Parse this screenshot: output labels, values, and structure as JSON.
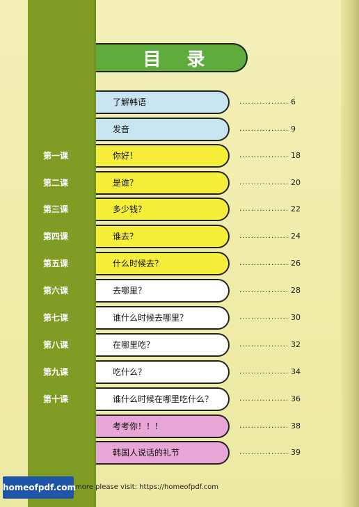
{
  "title": "目 录",
  "rows": [
    {
      "lesson": "",
      "label": "了解韩语",
      "page": "6",
      "color": "#c9e5f2"
    },
    {
      "lesson": "",
      "label": "发音",
      "page": "9",
      "color": "#c9e5f2"
    },
    {
      "lesson": "第一课",
      "label": "你好！",
      "page": "18",
      "color": "#f6ef3a"
    },
    {
      "lesson": "第二课",
      "label": "是谁？",
      "page": "20",
      "color": "#f6ef3a"
    },
    {
      "lesson": "第三课",
      "label": "多少钱？",
      "page": "22",
      "color": "#f6ef3a"
    },
    {
      "lesson": "第四课",
      "label": "谁去？",
      "page": "24",
      "color": "#f6ef3a"
    },
    {
      "lesson": "第五课",
      "label": "什么时候去？",
      "page": "26",
      "color": "#f6ef3a"
    },
    {
      "lesson": "第六课",
      "label": "去哪里？",
      "page": "28",
      "color": "#ffffff"
    },
    {
      "lesson": "第七课",
      "label": "谁什么时候去哪里？",
      "page": "30",
      "color": "#ffffff"
    },
    {
      "lesson": "第八课",
      "label": "在哪里吃？",
      "page": "32",
      "color": "#ffffff"
    },
    {
      "lesson": "第九课",
      "label": "吃什么？",
      "page": "34",
      "color": "#ffffff"
    },
    {
      "lesson": "第十课",
      "label": "谁什么时候在哪里吃什么？",
      "page": "36",
      "color": "#ffffff"
    },
    {
      "lesson": "",
      "label": "考考你！！！",
      "page": "38",
      "color": "#e7a6d5"
    },
    {
      "lesson": "",
      "label": "韩国人说话的礼节",
      "page": "39",
      "color": "#e7a6d5"
    }
  ],
  "leader": "......................",
  "footer": {
    "logo": "homeofpdf.com",
    "note": "more please visit: https://homeofpdf.com"
  },
  "colors": {
    "sidebar": "#7f9d25",
    "banner": "#5fab3e",
    "page_bg": "#f2efb6"
  }
}
